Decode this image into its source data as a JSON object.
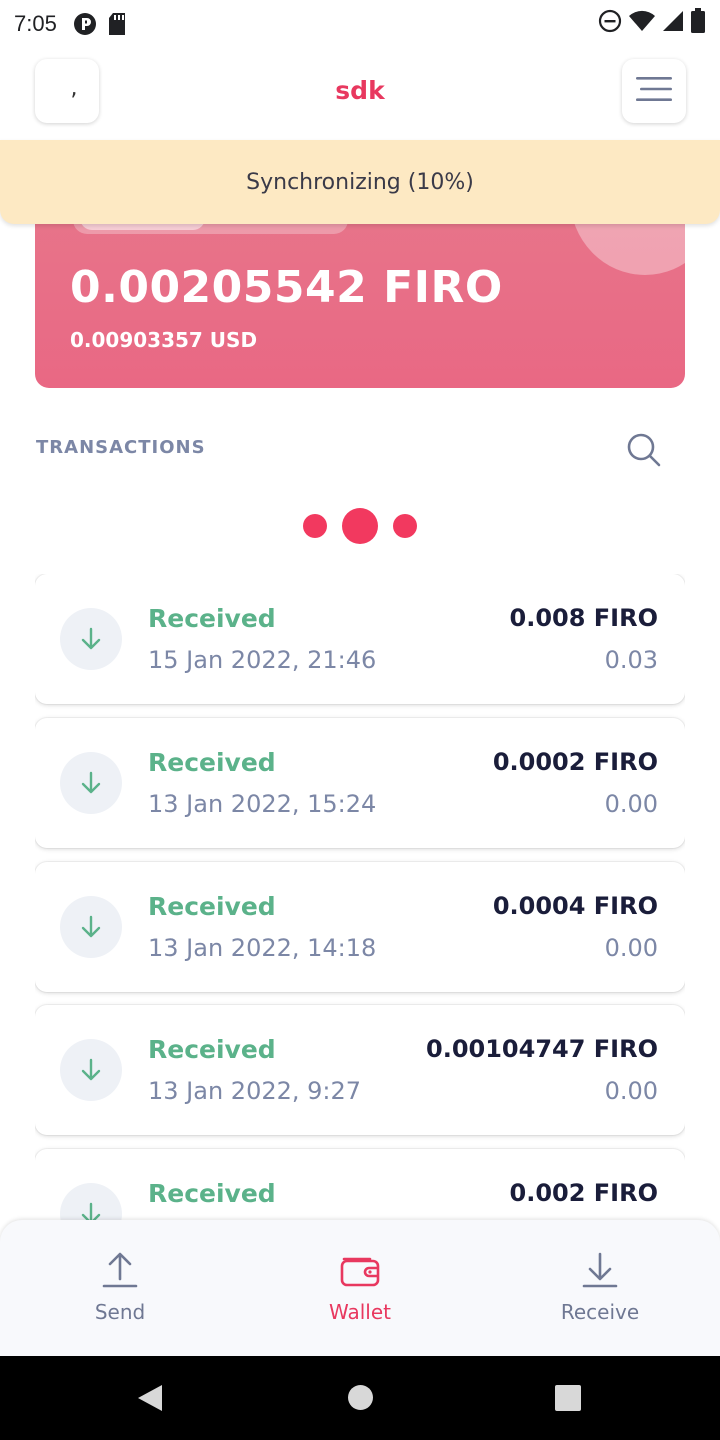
{
  "status_bar": {
    "time": "7:05"
  },
  "header": {
    "title": "sdk",
    "left_glyph": ","
  },
  "sync": {
    "text": "Synchronizing (10%)"
  },
  "balance": {
    "amount": "0.00205542 FIRO",
    "fiat": "0.00903357 USD"
  },
  "transactions": {
    "heading": "TRANSACTIONS",
    "items": [
      {
        "type": "Received",
        "date": "15 Jan 2022, 21:46",
        "amount": "0.008 FIRO",
        "fiat": "0.03"
      },
      {
        "type": "Received",
        "date": "13 Jan 2022, 15:24",
        "amount": "0.0002 FIRO",
        "fiat": "0.00"
      },
      {
        "type": "Received",
        "date": "13 Jan 2022, 14:18",
        "amount": "0.0004 FIRO",
        "fiat": "0.00"
      },
      {
        "type": "Received",
        "date": "13 Jan 2022, 9:27",
        "amount": "0.00104747 FIRO",
        "fiat": "0.00"
      },
      {
        "type": "Received",
        "date": "",
        "amount": "0.002 FIRO",
        "fiat": ""
      }
    ]
  },
  "nav": {
    "send": "Send",
    "wallet": "Wallet",
    "receive": "Receive"
  },
  "colors": {
    "accent": "#e8385f",
    "received": "#5bb28a",
    "muted": "#7c87a6",
    "sync_bg": "#fde9c3"
  }
}
